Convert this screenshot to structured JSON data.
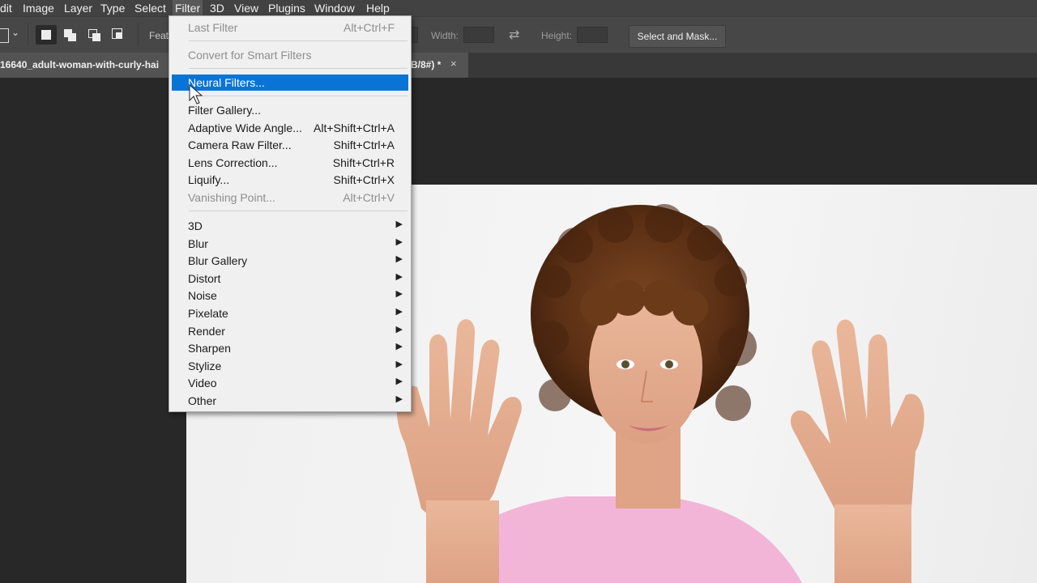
{
  "menubar": {
    "items": [
      "dit",
      "Image",
      "Layer",
      "Type",
      "Select",
      "Filter",
      "3D",
      "View",
      "Plugins",
      "Window",
      "Help"
    ],
    "active": "Filter"
  },
  "options_bar": {
    "feather_label": "Feath",
    "width_label": "Width:",
    "height_label": "Height:",
    "select_and_mask": "Select and Mask..."
  },
  "document_tab": {
    "title_start": "16640_adult-woman-with-curly-hai",
    "title_end": "B/8#) *",
    "close": "×"
  },
  "filter_menu": {
    "items": [
      {
        "label": "Last Filter",
        "shortcut": "Alt+Ctrl+F",
        "disabled": true
      },
      {
        "label": "Convert for Smart Filters",
        "shortcut": "",
        "disabled": true
      },
      {
        "label": "Neural Filters...",
        "shortcut": "",
        "highlighted": true
      },
      {
        "label": "Filter Gallery...",
        "shortcut": ""
      },
      {
        "label": "Adaptive Wide Angle...",
        "shortcut": "Alt+Shift+Ctrl+A"
      },
      {
        "label": "Camera Raw Filter...",
        "shortcut": "Shift+Ctrl+A"
      },
      {
        "label": "Lens Correction...",
        "shortcut": "Shift+Ctrl+R"
      },
      {
        "label": "Liquify...",
        "shortcut": "Shift+Ctrl+X"
      },
      {
        "label": "Vanishing Point...",
        "shortcut": "Alt+Ctrl+V",
        "disabled": true
      },
      {
        "label": "3D",
        "submenu": true
      },
      {
        "label": "Blur",
        "submenu": true
      },
      {
        "label": "Blur Gallery",
        "submenu": true
      },
      {
        "label": "Distort",
        "submenu": true
      },
      {
        "label": "Noise",
        "submenu": true
      },
      {
        "label": "Pixelate",
        "submenu": true
      },
      {
        "label": "Render",
        "submenu": true
      },
      {
        "label": "Sharpen",
        "submenu": true
      },
      {
        "label": "Stylize",
        "submenu": true
      },
      {
        "label": "Video",
        "submenu": true
      },
      {
        "label": "Other",
        "submenu": true
      }
    ]
  },
  "colors": {
    "menu_highlight": "#0a74d6",
    "menubar_bg": "#424242",
    "workspace_bg": "#282828"
  },
  "icons": {
    "submenu_arrow": "triangle-right-icon",
    "cursor": "arrow-cursor-icon"
  }
}
